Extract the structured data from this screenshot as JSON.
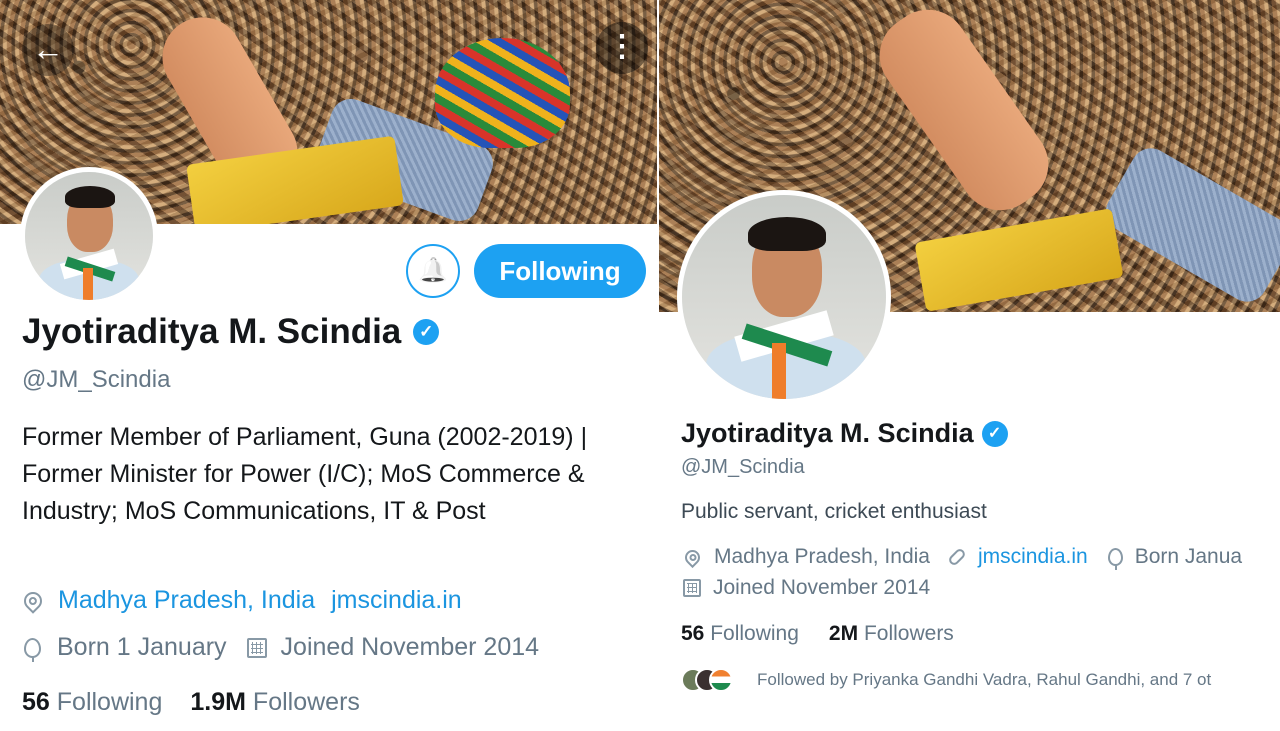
{
  "left": {
    "nav": {
      "back_glyph": "←",
      "more_glyph": "⋮"
    },
    "actions": {
      "notify_glyph": "🔔",
      "follow_label": "Following"
    },
    "profile": {
      "name": "Jyotiraditya M. Scindia",
      "verified_glyph": "✓",
      "handle": "@JM_Scindia",
      "bio": "Former Member of Parliament, Guna (2002-2019) |  Former Minister for Power (I/C); MoS Commerce & Industry; MoS Communications, IT & Post",
      "location": "Madhya Pradesh, India",
      "website": "jmscindia.in",
      "birthday": "Born 1 January",
      "joined": "Joined November 2014",
      "following_count": "56",
      "following_label": "Following",
      "followers_count": "1.9M",
      "followers_label": "Followers"
    }
  },
  "right": {
    "profile": {
      "name": "Jyotiraditya M. Scindia",
      "verified_glyph": "✓",
      "handle": "@JM_Scindia",
      "bio": "Public servant, cricket enthusiast",
      "location": "Madhya Pradesh, India",
      "website": "jmscindia.in",
      "birthday": "Born Janua",
      "joined": "Joined November 2014",
      "following_count": "56",
      "following_label": "Following",
      "followers_count": "2M",
      "followers_label": "Followers",
      "followed_by": "Followed by Priyanka Gandhi Vadra, Rahul Gandhi, and 7 ot"
    }
  },
  "colors": {
    "accent": "#1da1f2",
    "link": "#1b95e0",
    "muted": "#657786"
  },
  "icons": [
    "back-arrow-icon",
    "more-options-icon",
    "bell-icon",
    "verified-badge-icon",
    "location-pin-icon",
    "link-icon",
    "balloon-icon",
    "calendar-icon"
  ]
}
